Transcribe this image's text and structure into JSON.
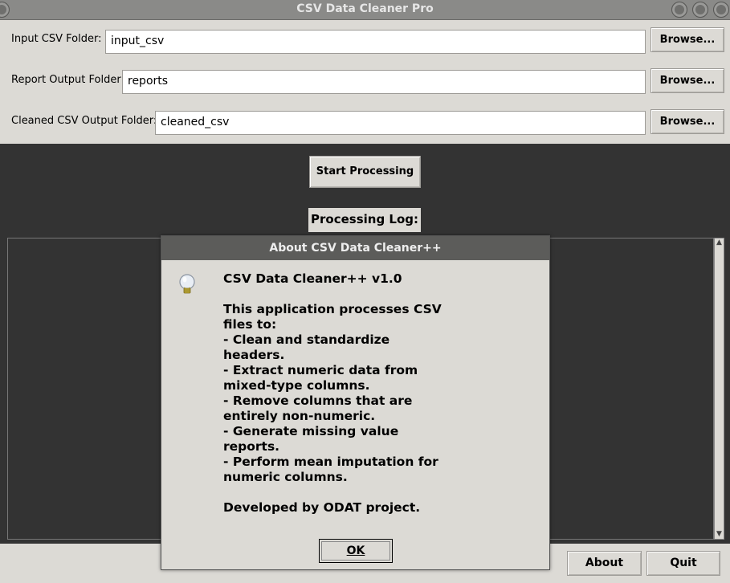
{
  "window": {
    "title": "CSV Data Cleaner Pro"
  },
  "form": {
    "input_label": "Input CSV Folder:",
    "input_value": "input_csv",
    "report_label": "Report Output Folder:",
    "report_value": "reports",
    "cleaned_label": "Cleaned CSV Output Folder:",
    "cleaned_value": "cleaned_csv",
    "browse_label": "Browse..."
  },
  "main": {
    "start_label": "Start Processing",
    "log_label": "Processing Log:"
  },
  "bottom": {
    "about_label": "About",
    "quit_label": "Quit"
  },
  "dialog": {
    "title": "About CSV Data Cleaner++",
    "icon": "lightbulb-icon",
    "message": "CSV Data Cleaner++ v1.0\n\nThis application processes CSV\nfiles to:\n- Clean and standardize\nheaders.\n- Extract numeric data from\nmixed-type columns.\n- Remove columns that are\nentirely non-numeric.\n- Generate missing value\nreports.\n- Perform mean imputation for\nnumeric columns.\n\nDeveloped by ODAT project.",
    "ok_label": "OK"
  }
}
